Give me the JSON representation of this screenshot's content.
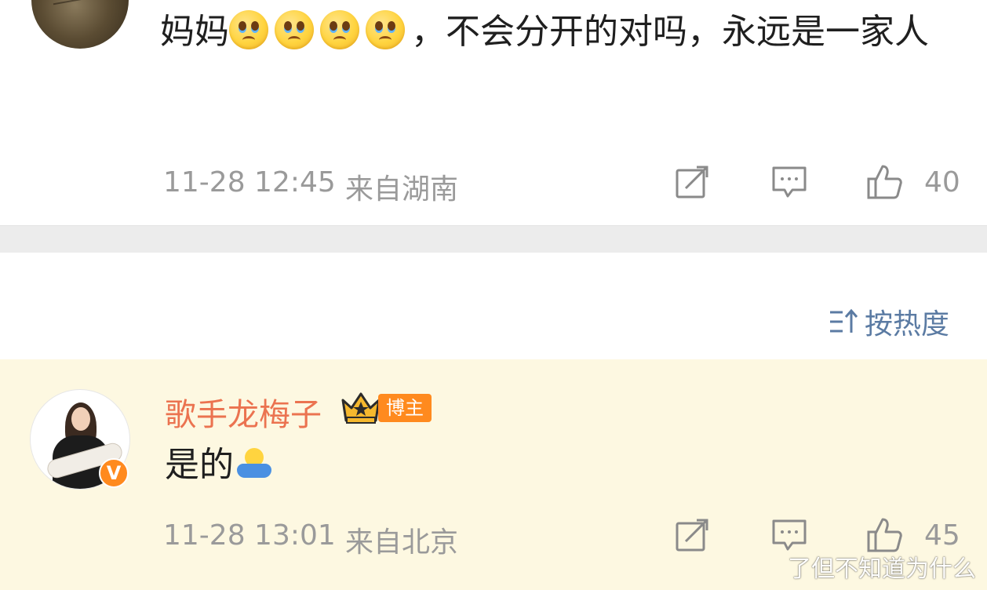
{
  "first_comment": {
    "text_before": "妈妈",
    "emoji": [
      "crying-face-emoji",
      "crying-face-emoji",
      "crying-face-emoji",
      "crying-face-emoji"
    ],
    "text_after": "，不会分开的对吗，永远是一家人",
    "timestamp": "11-28 12:45",
    "location": "来自湖南",
    "like_count": "40"
  },
  "sort": {
    "label": "按热度",
    "icon": "sort-icon",
    "color": "#5b7ba3"
  },
  "blogger_comment": {
    "username": "歌手龙梅子",
    "username_color": "#eb7350",
    "badge_label": "博主",
    "badge_color": "#ff8a1e",
    "verified_mark": "V",
    "text": "是的",
    "emoji": "hug-emoji",
    "background": "#fdf8e1",
    "timestamp": "11-28 13:01",
    "location": "来自北京",
    "like_count": "45"
  },
  "watermark": "了但不知道为什么"
}
